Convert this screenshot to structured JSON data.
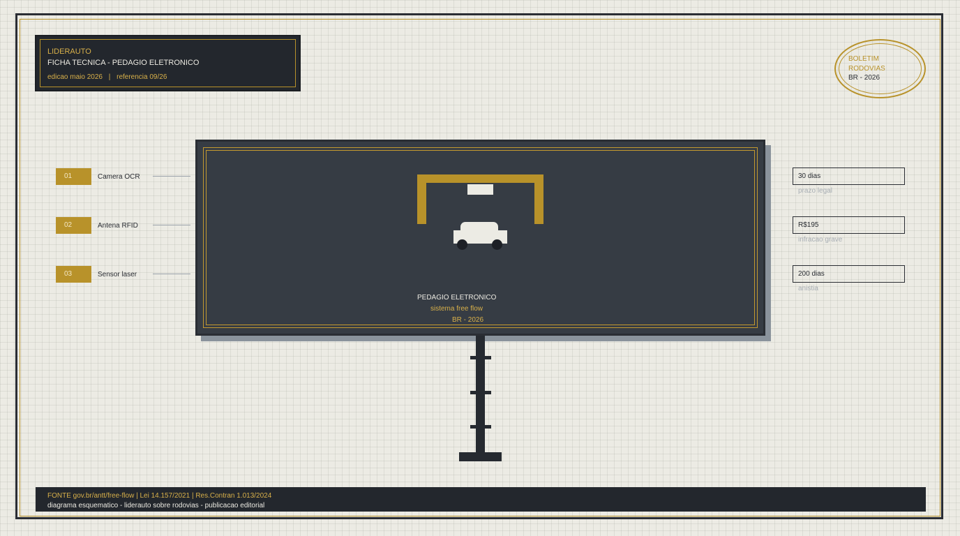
{
  "header": {
    "brand": "LIDERAUTO",
    "title": "FICHA TECNICA - PEDAGIO ELETRONICO",
    "edition": "edicao maio 2026",
    "separator": "|",
    "reference": "referencia 09/26"
  },
  "stamp": {
    "line1": "BOLETIM",
    "line2": "RODOVIAS",
    "line3": "BR - 2026"
  },
  "board": {
    "title": "PEDAGIO ELETRONICO",
    "subtitle": "sistema free flow",
    "tag": "BR - 2026"
  },
  "components": [
    {
      "number": "01",
      "label": "Camera OCR"
    },
    {
      "number": "02",
      "label": "Antena RFID"
    },
    {
      "number": "03",
      "label": "Sensor laser"
    }
  ],
  "stats": [
    {
      "value": "30 dias",
      "caption": "prazo legal"
    },
    {
      "value": "R$195",
      "caption": "infracao grave"
    },
    {
      "value": "200 dias",
      "caption": "anistia"
    }
  ],
  "footer": {
    "line1": "FONTE gov.br/antt/free-flow  |  Lei 14.157/2021  |  Res.Contran 1.013/2024",
    "line2": "diagrama esquematico - liderauto sobre rodovias - publicacao editorial"
  },
  "colors": {
    "background": "#ecebe4",
    "dark": "#23272d",
    "gold": "#b8922a",
    "board": "#363c44"
  }
}
